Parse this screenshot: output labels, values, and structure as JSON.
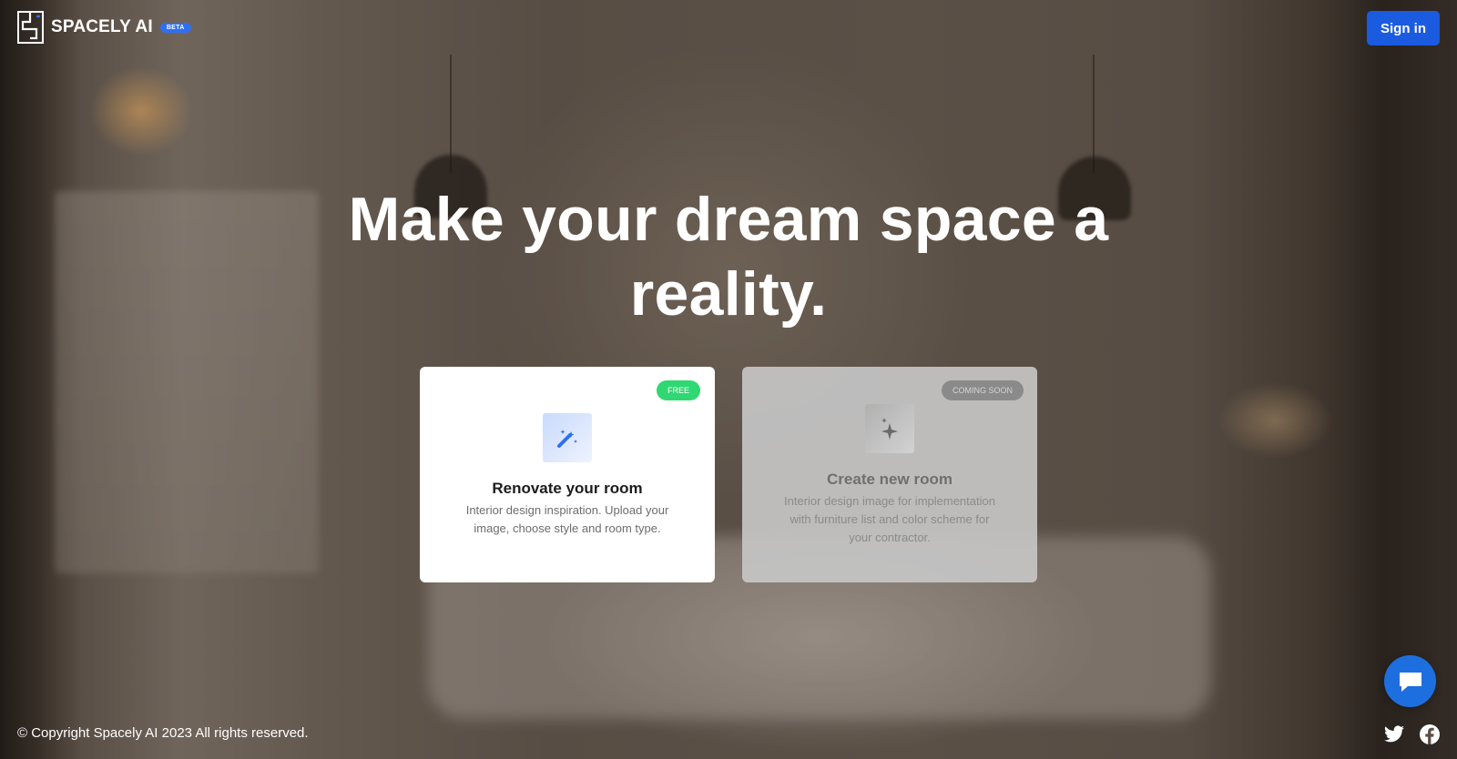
{
  "app": {
    "brand": "SPACELY AI",
    "beta_badge": "BETA"
  },
  "header": {
    "signin_label": "Sign in"
  },
  "hero": {
    "title": "Make your dream space a reality."
  },
  "cards": [
    {
      "badge": "FREE",
      "title": "Renovate your room",
      "description": "Interior design inspiration. Upload your image, choose style and room type.",
      "icon": "magic-wand-icon"
    },
    {
      "badge": "COMING SOON",
      "title": "Create new room",
      "description": "Interior design image for implementation with furniture list and color scheme for your contractor.",
      "icon": "sparkle-icon"
    }
  ],
  "footer": {
    "copyright": "© Copyright Spacely AI 2023 All rights reserved."
  },
  "icons": {
    "chat": "chat-bubble-icon",
    "twitter": "twitter-icon",
    "facebook": "facebook-icon"
  },
  "colors": {
    "accent": "#1a5be0",
    "free_badge": "#2fd872",
    "soon_badge": "#8a8a8a",
    "chat_button": "#1d6fe0"
  }
}
